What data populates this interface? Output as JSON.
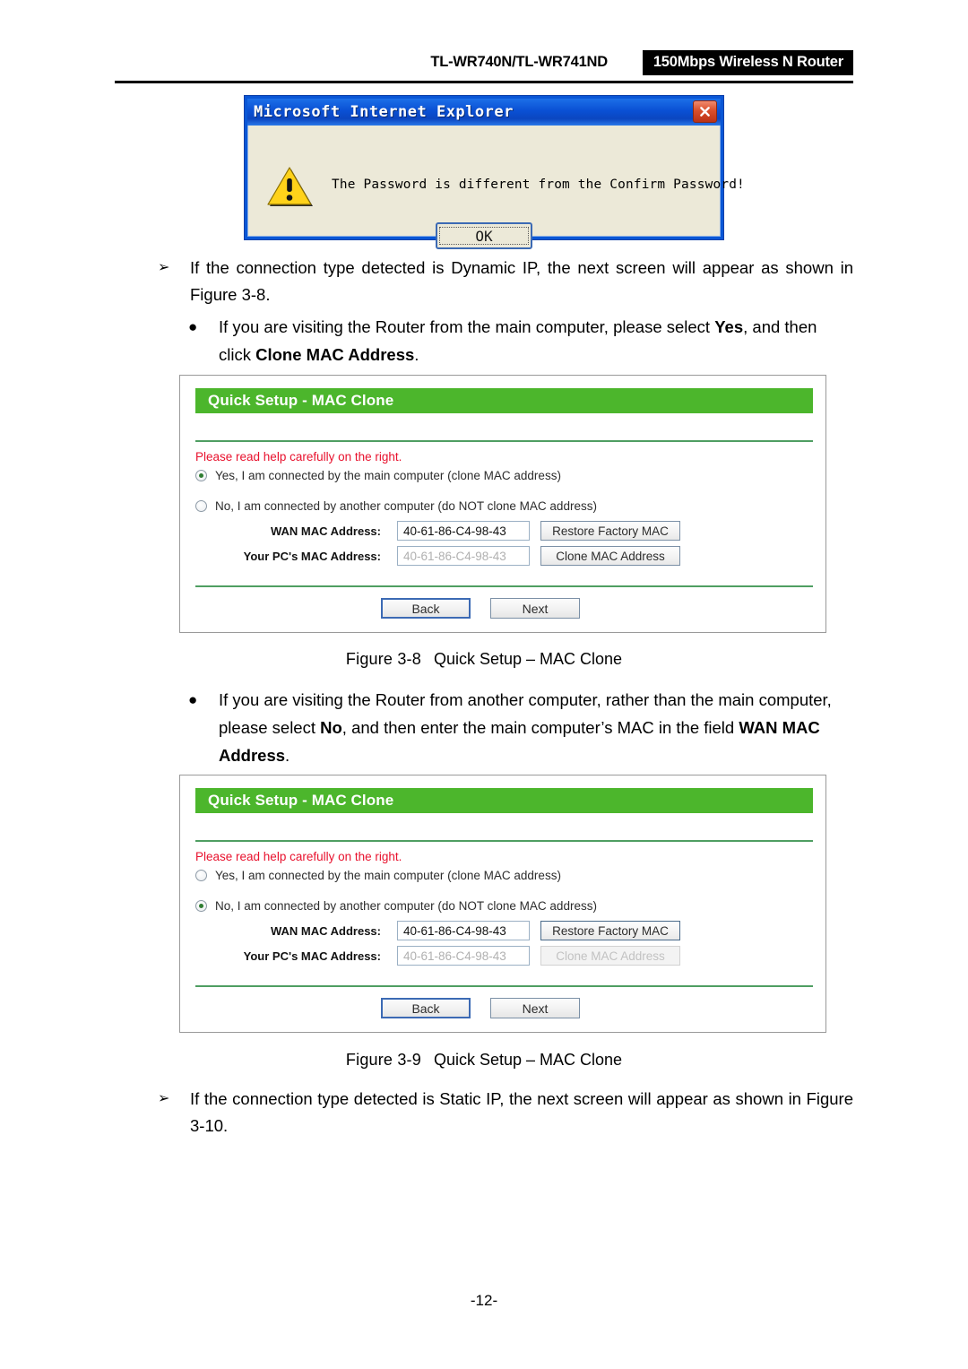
{
  "header": {
    "model": "TL-WR740N/TL-WR741ND",
    "badge": "150Mbps Wireless N Router"
  },
  "dialog": {
    "title": "Microsoft Internet Explorer",
    "message": "The Password is different from the Confirm Password!",
    "ok_label": "OK",
    "close_icon": "close-icon",
    "warning_icon": "warning-triangle-icon"
  },
  "body": {
    "arrow_1": "If the connection type detected is Dynamic IP, the next screen will appear as shown in Figure 3-8.",
    "arrow_1_marker": "➢",
    "bullet_1_part1": "If you are visiting the Router from the main computer, please select ",
    "bullet_1_bold1": "Yes",
    "bullet_1_part2": ", and then click ",
    "bullet_1_bold2": "Clone MAC Address",
    "bullet_1_part3": ".",
    "bullet_marker": "●",
    "bullet_2_part1": "If you are visiting the Router from another computer, rather than the main computer, please select ",
    "bullet_2_bold1": "No",
    "bullet_2_part2": ", and then enter the main computer’s MAC in the field ",
    "bullet_2_bold2": "WAN MAC Address",
    "bullet_2_part3": ".",
    "arrow_2": "If the connection type detected is Static IP, the next screen will appear as shown in Figure 3-10."
  },
  "captions": {
    "fig_8_num": "Figure 3-8",
    "fig_8_text": "Quick Setup – MAC Clone",
    "fig_9_num": "Figure 3-9",
    "fig_9_text": "Quick Setup – MAC Clone"
  },
  "panel_1": {
    "title": "Quick Setup - MAC Clone",
    "note": "Please read help carefully on the right.",
    "radio_yes": "Yes, I am connected by the main computer (clone MAC address)",
    "radio_no": "No, I am connected by another computer (do NOT clone MAC address)",
    "wan_label": "WAN MAC Address:",
    "wan_value": "40-61-86-C4-98-43",
    "pc_label": "Your PC's MAC Address:",
    "pc_value": "40-61-86-C4-98-43",
    "restore_btn": "Restore Factory MAC",
    "clone_btn": "Clone MAC Address",
    "back_btn": "Back",
    "next_btn": "Next"
  },
  "panel_2": {
    "title": "Quick Setup - MAC Clone",
    "note": "Please read help carefully on the right.",
    "radio_yes": "Yes, I am connected by the main computer (clone MAC address)",
    "radio_no": "No, I am connected by another computer (do NOT clone MAC address)",
    "wan_label": "WAN MAC Address:",
    "wan_value": "40-61-86-C4-98-43",
    "pc_label": "Your PC's MAC Address:",
    "pc_value": "40-61-86-C4-98-43",
    "restore_btn": "Restore Factory MAC",
    "clone_btn": "Clone MAC Address",
    "back_btn": "Back",
    "next_btn": "Next"
  },
  "footer": {
    "page_number": "-12-"
  },
  "colors": {
    "panel_header_green": "#4cb62c",
    "note_red": "#e8112d",
    "title_bar_blue": "#0a50d4",
    "badge_black": "#000000"
  }
}
